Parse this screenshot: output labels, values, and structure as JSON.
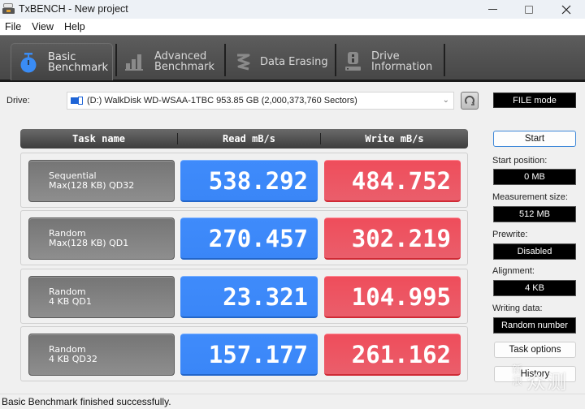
{
  "window": {
    "title": "TxBENCH - New project",
    "controls": {
      "minimize": "minimize",
      "maximize": "maximize",
      "close": "close"
    }
  },
  "menu": [
    "File",
    "View",
    "Help"
  ],
  "toolbar": {
    "tabs": [
      {
        "line1": "Basic",
        "line2": "Benchmark",
        "icon": "stopwatch-icon",
        "active": true
      },
      {
        "line1": "Advanced",
        "line2": "Benchmark",
        "icon": "bar-chart-icon",
        "active": false
      },
      {
        "line1": "Data Erasing",
        "line2": "",
        "icon": "eraser-spring-icon",
        "active": false
      },
      {
        "line1": "Drive",
        "line2": "Information",
        "icon": "drive-info-icon",
        "active": false
      }
    ]
  },
  "drive": {
    "label": "Drive:",
    "selected": "(D:) WalkDisk WD-WSAA-1TBC  953.85 GB (2,000,373,760 Sectors)",
    "mode": "FILE mode"
  },
  "results": {
    "headers": {
      "task": "Task name",
      "read": "Read mB/s",
      "write": "Write mB/s"
    },
    "rows": [
      {
        "line1": "Sequential",
        "line2": "Max(128 KB) QD32",
        "read": "538.292",
        "write": "484.752"
      },
      {
        "line1": "Random",
        "line2": "Max(128 KB) QD1",
        "read": "270.457",
        "write": "302.219"
      },
      {
        "line1": "Random",
        "line2": "4 KB QD1",
        "read": "23.321",
        "write": "104.995"
      },
      {
        "line1": "Random",
        "line2": "4 KB QD32",
        "read": "157.177",
        "write": "261.162"
      }
    ],
    "colors": {
      "read": "#3d89f9",
      "write": "#ec5563",
      "task": "#7f7f7f"
    }
  },
  "panel": {
    "start": "Start",
    "params": [
      {
        "label": "Start position:",
        "value": "0 MB"
      },
      {
        "label": "Measurement size:",
        "value": "512 MB"
      },
      {
        "label": "Prewrite:",
        "value": "Disabled"
      },
      {
        "label": "Alignment:",
        "value": "4 KB"
      },
      {
        "label": "Writing data:",
        "value": "Random number"
      }
    ],
    "task_options": "Task options",
    "history": "History"
  },
  "status": "Basic Benchmark finished successfully.",
  "watermark": {
    "small": "新浪",
    "big": "众测"
  }
}
